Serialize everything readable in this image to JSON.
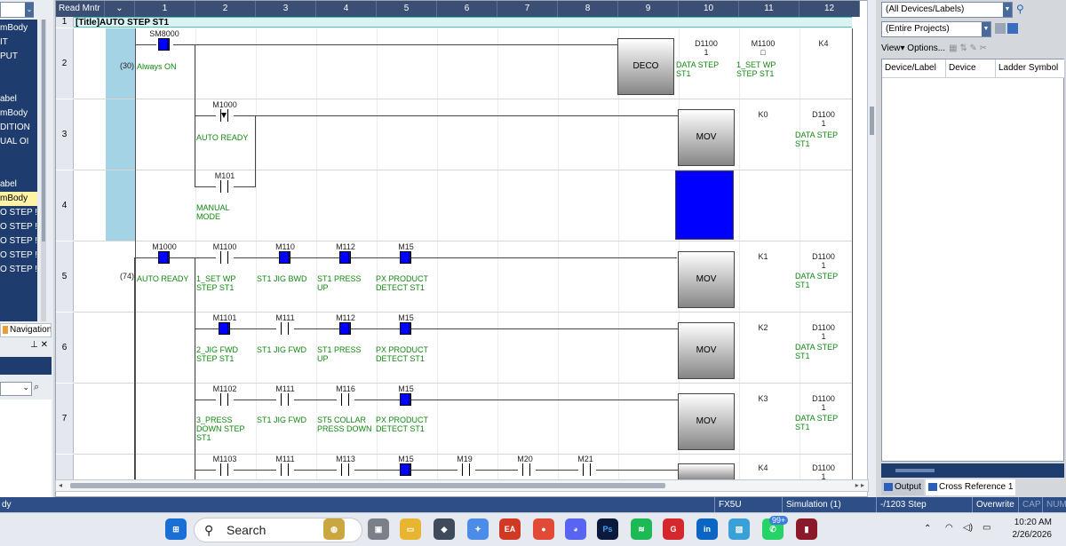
{
  "leftpane": {
    "tree_items": [
      {
        "label": "mBody",
        "sel": false
      },
      {
        "label": "IT",
        "sel": false
      },
      {
        "label": "PUT",
        "sel": false
      },
      {
        "label": "",
        "sel": false
      },
      {
        "label": "",
        "sel": false
      },
      {
        "label": "abel",
        "sel": false
      },
      {
        "label": "mBody",
        "sel": false
      },
      {
        "label": "DITION",
        "sel": false
      },
      {
        "label": "UAL OI",
        "sel": false
      },
      {
        "label": "",
        "sel": false
      },
      {
        "label": "",
        "sel": false
      },
      {
        "label": "abel",
        "sel": false
      },
      {
        "label": "mBody",
        "sel": true
      },
      {
        "label": "O STEP !",
        "sel": false
      },
      {
        "label": "O STEP !",
        "sel": false
      },
      {
        "label": "O STEP !",
        "sel": false
      },
      {
        "label": "O STEP !",
        "sel": false
      },
      {
        "label": "O STEP !",
        "sel": false
      }
    ],
    "nav_tab": "Navigation",
    "pin": "⊥ ✕",
    "search_icon": "⌕",
    "combo_arrow": "⌄"
  },
  "ladder": {
    "headers": [
      {
        "label": "Read Mntr",
        "w": 55
      },
      {
        "label": "⌄",
        "w": 34
      },
      {
        "label": "1",
        "w": 68
      },
      {
        "label": "2",
        "w": 68
      },
      {
        "label": "3",
        "w": 68
      },
      {
        "label": "4",
        "w": 68
      },
      {
        "label": "5",
        "w": 68
      },
      {
        "label": "6",
        "w": 68
      },
      {
        "label": "7",
        "w": 68
      },
      {
        "label": "8",
        "w": 68
      },
      {
        "label": "9",
        "w": 68
      },
      {
        "label": "10",
        "w": 68
      },
      {
        "label": "11",
        "w": 68
      },
      {
        "label": "12",
        "w": 68
      }
    ],
    "title": "[Title]AUTO STEP ST1",
    "rows": [
      "1",
      "2",
      "3",
      "4",
      "5",
      "6",
      "7"
    ],
    "row2": {
      "step": "(30)",
      "contact": "SM8000",
      "comment": "Always ON",
      "instr": "DECO",
      "op1": "D1100\n1",
      "op1c": "DATA STEP\nST1",
      "op2": "M1100\n□",
      "op2c": "1_SET WP\nSTEP ST1",
      "op3": "K4"
    },
    "row3": {
      "contact": "M1000",
      "comment": "AUTO READY",
      "instr": "MOV",
      "op1": "K0",
      "op2": "D1100\n1",
      "op2c": "DATA STEP\nST1"
    },
    "row4": {
      "contact": "M101",
      "comment": "MANUAL\nMODE"
    },
    "row5": {
      "step": "(74)",
      "c1": "M1000",
      "c1c": "AUTO READY",
      "c2": "M1100",
      "c2c": "1_SET WP\nSTEP ST1",
      "c3": "M110",
      "c3c": "ST1 JIG BWD",
      "c4": "M112",
      "c4c": "ST1 PRESS\nUP",
      "c5": "M15",
      "c5c": "PX PRODUCT\nDETECT ST1",
      "instr": "MOV",
      "op1": "K1",
      "op2": "D1100\n1",
      "op2c": "DATA STEP\nST1"
    },
    "row6": {
      "c2": "M1101",
      "c2c": "2_JIG FWD\nSTEP ST1",
      "c3": "M111",
      "c3c": "ST1 JIG FWD",
      "c4": "M112",
      "c4c": "ST1 PRESS\nUP",
      "c5": "M15",
      "c5c": "PX PRODUCT\nDETECT ST1",
      "instr": "MOV",
      "op1": "K2",
      "op2": "D1100\n1",
      "op2c": "DATA STEP\nST1"
    },
    "row7": {
      "c2": "M1102",
      "c2c": "3_PRESS\nDOWN STEP\nST1",
      "c3": "M111",
      "c3c": "ST1 JIG FWD",
      "c4": "M116",
      "c4c": "ST5 COLLAR\nPRESS DOWN",
      "c5": "M15",
      "c5c": "PX PRODUCT\nDETECT ST1",
      "instr": "MOV",
      "op1": "K3",
      "op2": "D1100\n1",
      "op2c": "DATA STEP\nST1"
    },
    "row8": {
      "c2": "M1103",
      "c3": "M111",
      "c4": "M113",
      "c5": "M15",
      "c6": "M19",
      "c7": "M20",
      "c8": "M21",
      "op1": "K4",
      "op2": "D1100\n1"
    },
    "hscroll_left": "◂",
    "hscroll_right": "▸ ▸"
  },
  "rightpane": {
    "combo1": "(All Devices/Labels)",
    "combo2": "(Entire Projects)",
    "toolbar": "View▾ Options...",
    "cols": [
      {
        "label": "Device/Label",
        "w": 72
      },
      {
        "label": "Device",
        "w": 56
      },
      {
        "label": "Ladder Symbol",
        "w": 78
      }
    ],
    "tab_output": "Output",
    "tab_xref": "Cross Reference 1"
  },
  "statusbar": {
    "cpu": "FX5U",
    "mode": "Simulation (1)",
    "step": "-/1203 Step",
    "ovr": "Overwrite",
    "cap": "CAP",
    "num": "NUM",
    "left": "dy"
  },
  "taskbar": {
    "search": "Search",
    "time": "10:20 AM",
    "date": "2/26/2026",
    "badge": "99+",
    "up_arrow": "⌃"
  }
}
